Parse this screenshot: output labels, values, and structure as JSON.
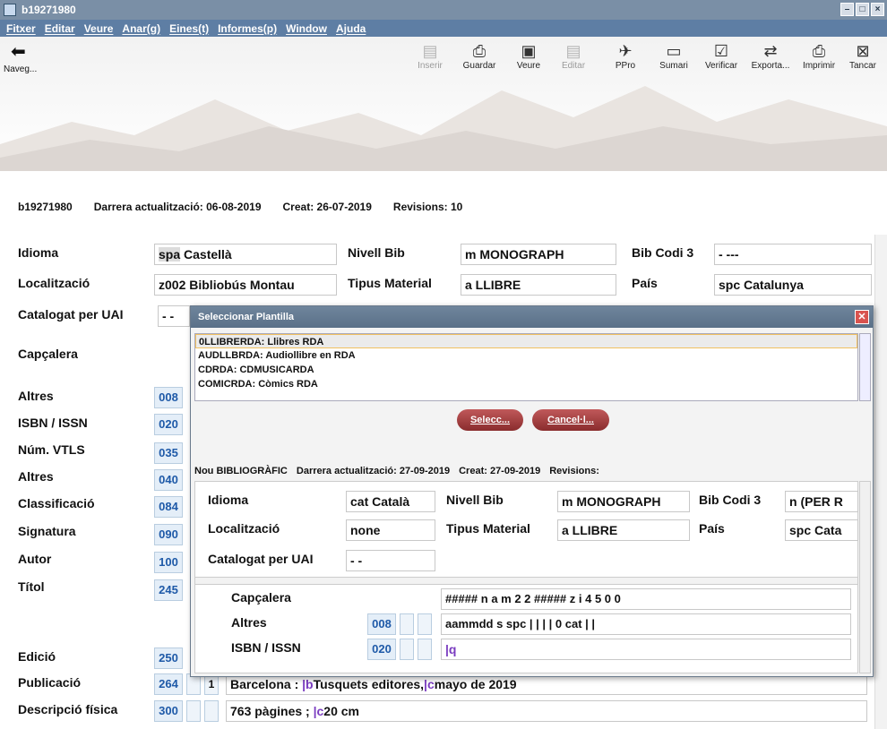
{
  "window": {
    "title": "b19271980",
    "min": "–",
    "max": "□",
    "close": "×"
  },
  "menu": [
    "Fitxer",
    "Editar",
    "Veure",
    "Anar(g)",
    "Eines(t)",
    "Informes(p)",
    "Window",
    "Ajuda"
  ],
  "toolbar": {
    "nav_label": "Naveg...",
    "tools": [
      {
        "label": "Inserir",
        "icon": "insert-icon",
        "glyph": "▤",
        "enabled": false
      },
      {
        "label": "Guardar",
        "icon": "save-icon",
        "glyph": "⎙",
        "enabled": true
      },
      {
        "label": "Veure",
        "icon": "view-icon",
        "glyph": "▣",
        "enabled": true
      },
      {
        "label": "Editar",
        "icon": "edit-icon",
        "glyph": "▤",
        "enabled": false
      },
      {
        "label": "PPro",
        "icon": "ppro-icon",
        "glyph": "✈",
        "enabled": true
      },
      {
        "label": "Sumari",
        "icon": "summary-icon",
        "glyph": "▭",
        "enabled": true
      },
      {
        "label": "Verificar",
        "icon": "verify-icon",
        "glyph": "☑",
        "enabled": true
      },
      {
        "label": "Exporta...",
        "icon": "export-icon",
        "glyph": "⇄",
        "enabled": true
      },
      {
        "label": "Imprimir",
        "icon": "print-icon",
        "glyph": "⎙",
        "enabled": true
      },
      {
        "label": "Tancar",
        "icon": "close-record-icon",
        "glyph": "⊠",
        "enabled": true
      }
    ]
  },
  "record": {
    "id": "b19271980",
    "updated": "Darrera actualització: 06-08-2019",
    "created": "Creat: 26-07-2019",
    "revisions": "Revisions: 10"
  },
  "fixed": {
    "idioma_label": "Idioma",
    "idioma_code": "spa",
    "idioma_value": "Castellà",
    "nivell_label": "Nivell Bib",
    "nivell_value": "m MONOGRAPH",
    "bibcodi_label": "Bib Codi 3",
    "bibcodi_value": "- ---",
    "loc_label": "Localització",
    "loc_value": "z002  Bibliobús Montau",
    "tipus_label": "Tipus Material",
    "tipus_value": "a  LLIBRE",
    "pais_label": "País",
    "pais_value": "spc Catalunya",
    "uai_label": "Catalogat per UAI",
    "uai_value": "- -"
  },
  "fields": [
    {
      "label": "Capçalera",
      "tag": ""
    },
    {
      "label": "Altres",
      "tag": "008"
    },
    {
      "label": "ISBN / ISSN",
      "tag": "020"
    },
    {
      "label": "Núm. VTLS",
      "tag": "035"
    },
    {
      "label": "Altres",
      "tag": "040"
    },
    {
      "label": "Classificació",
      "tag": "084"
    },
    {
      "label": "Signatura",
      "tag": "090"
    },
    {
      "label": "Autor",
      "tag": "100"
    },
    {
      "label": "Títol",
      "tag": "245"
    },
    {
      "label": "Edició",
      "tag": "250"
    },
    {
      "label": "Publicació",
      "tag": "264",
      "ind2": "1",
      "value_a": "Barcelona : ",
      "sf_b": "|b",
      "value_b": "Tusquets editores,",
      "sf_c": "|c",
      "value_c": "mayo de 2019"
    },
    {
      "label": "Descripció física",
      "tag": "300",
      "value_a": "763 pàgines ; ",
      "sf_c": "|c",
      "value_c": "20 cm"
    }
  ],
  "dialog": {
    "title": "Seleccionar Plantilla",
    "templates": [
      "0LLIBRERDA: Llibres RDA",
      "AUDLLBRDA: Audiollibre en RDA",
      "CDRDA: CDMUSICARDA",
      "COMICRDA: Còmics RDA"
    ],
    "select_btn": "Selecc...",
    "cancel_btn": "Cancel·l...",
    "info_type": "Nou BIBLIOGRÀFIC",
    "info_updated": "Darrera actualització: 27-09-2019",
    "info_created": "Creat: 27-09-2019",
    "info_revisions": "Revisions:",
    "idioma_label": "Idioma",
    "idioma_value": "cat Català",
    "nivell_label": "Nivell Bib",
    "nivell_value": "m MONOGRAPH",
    "bibcodi_label": "Bib Codi 3",
    "bibcodi_value": "n (PER R",
    "loc_label": "Localització",
    "loc_value": "none",
    "tipus_label": "Tipus Material",
    "tipus_value": "a LLIBRE",
    "pais_label": "País",
    "pais_value": "spc Cata",
    "uai_label": "Catalogat per UAI",
    "uai_value": "- -",
    "capcalera_label": "Capçalera",
    "capcalera_value": "##### n a m    2 2 ##### z i   4 5 0 0",
    "altres_label": "Altres",
    "altres_tag": "008",
    "altres_value": "aammdd s            spc                     | | | |    0    cat | |",
    "isbn_label": "ISBN / ISSN",
    "isbn_tag": "020",
    "isbn_sf": "|q"
  }
}
